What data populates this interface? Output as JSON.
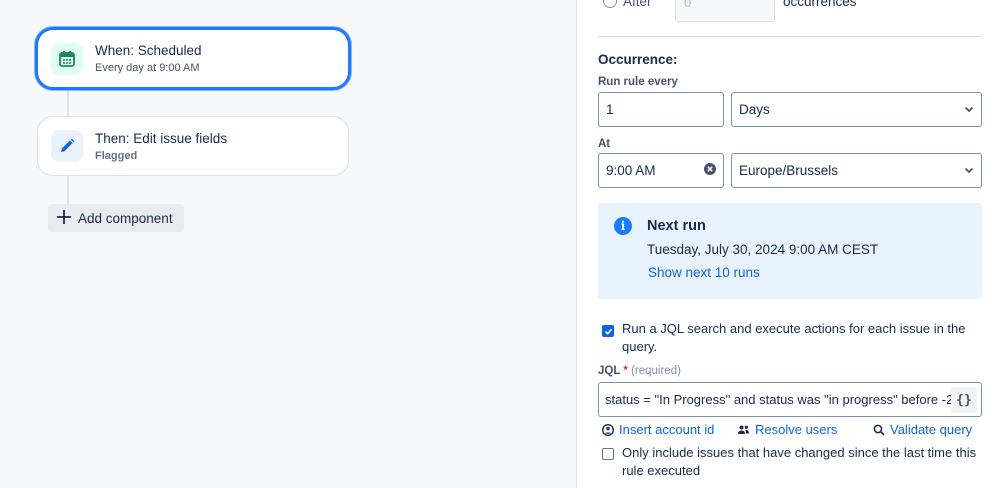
{
  "canvas": {
    "trigger": {
      "title": "When: Scheduled",
      "subtitle": "Every day at 9:00 AM"
    },
    "action": {
      "title": "Then: Edit issue fields",
      "subtitle": "Flagged"
    },
    "add_component_label": "Add component"
  },
  "panel": {
    "top_partial": {
      "radio_label": "After",
      "input_value": "0",
      "suffix": "occurrences"
    },
    "occurrence_title": "Occurrence:",
    "run_rule_every": {
      "label": "Run rule every",
      "value": "1",
      "unit_selected": "Days"
    },
    "at": {
      "label": "At",
      "time_value": "9:00 AM",
      "timezone_selected": "Europe/Brussels"
    },
    "next_run": {
      "title": "Next run",
      "date": "Tuesday, July 30, 2024 9:00 AM CEST",
      "link": "Show next 10 runs"
    },
    "jql_checkbox": {
      "checked": true,
      "label": "Run a JQL search and execute actions for each issue in the query."
    },
    "jql": {
      "label": "JQL",
      "required_marker": "*",
      "hint": "(required)",
      "value": "status = \"In Progress\" and status was \"in progress\" before -2",
      "braces": "{}"
    },
    "links": {
      "insert_account_id": "Insert account id",
      "resolve_users": "Resolve users",
      "validate_query": "Validate query"
    },
    "changed_checkbox": {
      "checked": false,
      "label": "Only include issues that have changed since the last time this rule executed"
    }
  },
  "colors": {
    "accent": "#0c66e4",
    "focus_ring": "#1d7afc",
    "info_bg": "#e9f2ff",
    "trigger_icon_bg": "#dcfff1"
  }
}
